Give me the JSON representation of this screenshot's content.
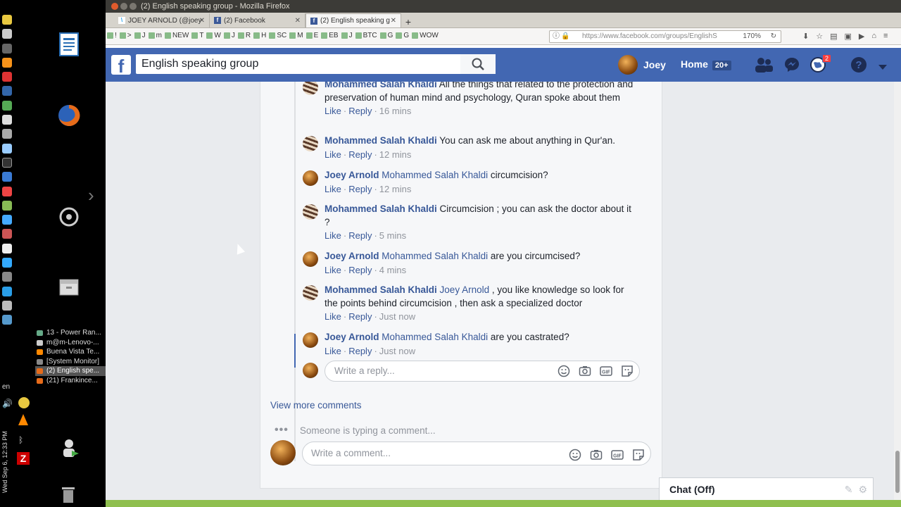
{
  "window": {
    "title": "(2) English speaking group - Mozilla Firefox"
  },
  "tabs": [
    {
      "label": "JOEY ARNOLD (@joey",
      "active": false
    },
    {
      "label": "(2) Facebook",
      "active": false
    },
    {
      "label": "(2) English speaking g",
      "active": true
    }
  ],
  "bookmarks": [
    "!",
    ">",
    "J",
    "m",
    "NEW",
    "T",
    "W",
    "J",
    "R",
    "H",
    "SC",
    "M",
    "E",
    "EB",
    "J",
    "BTC",
    "G",
    "G",
    "WOW"
  ],
  "url": {
    "value": "https://www.facebook.com/groups/EnglishS",
    "zoom": "170%"
  },
  "taskbar": {
    "items": [
      {
        "label": "13 - Power Ran...",
        "active": false,
        "color": "#6a8"
      },
      {
        "label": "m@m-Lenovo-...",
        "active": false,
        "color": "#ccc"
      },
      {
        "label": "Buena Vista Te...",
        "active": false,
        "color": "#f80"
      },
      {
        "label": "[System Monitor]",
        "active": false,
        "color": "#888"
      },
      {
        "label": "(2) English spe...",
        "active": true,
        "color": "#e66b1a"
      },
      {
        "label": "(21) Frankince...",
        "active": false,
        "color": "#e66b1a"
      }
    ],
    "clock": "Wed Sep 6, 12:33 PM",
    "lang": "en"
  },
  "fb": {
    "search_value": "English speaking group",
    "user_name": "Joey",
    "home_label": "Home",
    "home_count": "20+",
    "notif_count": "2"
  },
  "replies": [
    {
      "author": "Mohammed Salah Khaldi",
      "tag": "",
      "text": "All the things that related to the protection and preservation of human mind and psychology, Quran spoke about them",
      "time": "16 mins",
      "who": "mo"
    },
    {
      "author": "Mohammed Salah Khaldi",
      "tag": "",
      "text": "You can ask me about anything in Qur'an.",
      "time": "12 mins",
      "who": "mo"
    },
    {
      "author": "Joey Arnold",
      "tag": "Mohammed Salah Khaldi",
      "text": "circumcision?",
      "time": "12 mins",
      "who": "jo"
    },
    {
      "author": "Mohammed Salah Khaldi",
      "tag": "",
      "text": "Circumcision ; you can ask the doctor about it ?",
      "time": "5 mins",
      "who": "mo"
    },
    {
      "author": "Joey Arnold",
      "tag": "Mohammed Salah Khaldi",
      "text": "are you circumcised?",
      "time": "4 mins",
      "who": "jo"
    },
    {
      "author": "Mohammed Salah Khaldi",
      "tag": "Joey Arnold",
      "text": ", you like knowledge so look for the points behind circumcision , then ask a specialized doctor",
      "time": "Just now",
      "who": "mo"
    },
    {
      "author": "Joey Arnold",
      "tag": "Mohammed Salah Khaldi",
      "text": "are you castrated?",
      "time": "Just now",
      "who": "jo"
    }
  ],
  "actions": {
    "like": "Like",
    "reply": "Reply"
  },
  "reply_box": {
    "placeholder": "Write a reply..."
  },
  "view_more": "View more comments",
  "typing": "Someone is typing a comment...",
  "comment_box": {
    "placeholder": "Write a comment..."
  },
  "chat": {
    "label": "Chat (Off)"
  }
}
